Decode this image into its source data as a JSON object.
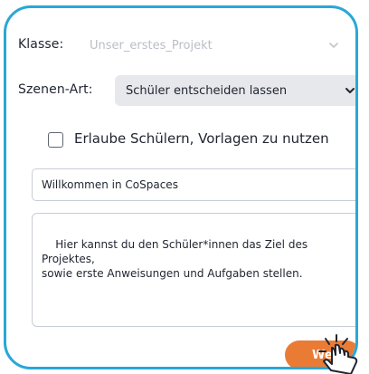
{
  "form": {
    "class_label": "Klasse:",
    "class_value": "Unser_erstes_Projekt",
    "scene_type_label": "Szenen-Art:",
    "scene_type_value": "Schüler entscheiden lassen",
    "allow_templates_label": "Erlaube Schülern, Vorlagen zu nutzen",
    "allow_templates_checked": false,
    "title_value": "Willkommen in CoSpaces",
    "description_value": "Hier kannst du den Schüler*innen das Ziel des Projektes,\nsowie erste Anweisungen und Aufgaben stellen.",
    "next_button_label": "We"
  },
  "icons": {
    "class_select_chevron": "chevron-down-icon",
    "scene_select_chevron": "chevron-down-icon",
    "cursor": "hand-pointer-icon"
  },
  "colors": {
    "frame_border": "#2aa7d8",
    "accent_button": "#ea7b35",
    "select_background": "#e6e8ec",
    "text_dark": "#1f2430",
    "text_faded": "#b9bec7"
  }
}
